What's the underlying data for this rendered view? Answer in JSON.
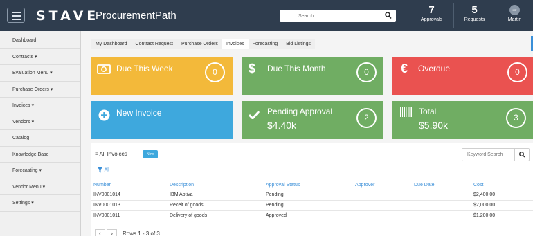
{
  "header": {
    "logo": "STAVE",
    "app_title": "ProcurementPath",
    "search_placeholder": "Search",
    "approvals": {
      "count": "7",
      "label": "Approvals"
    },
    "requests": {
      "count": "5",
      "label": "Requests"
    },
    "user": {
      "initials": "MP",
      "name": "Martin"
    },
    "colors": {
      "bar": "#2f3d4e"
    }
  },
  "sidebar": {
    "items": [
      {
        "label": "Dashboard"
      },
      {
        "label": "Contracts ▾"
      },
      {
        "label": "Evaluation Menu ▾"
      },
      {
        "label": "Purchase Orders ▾"
      },
      {
        "label": "Invoices ▾"
      },
      {
        "label": "Vendors ▾"
      },
      {
        "label": "Catalog"
      },
      {
        "label": "Knowledge Base"
      },
      {
        "label": "Forecasting ▾"
      },
      {
        "label": "Vendor Menu ▾"
      },
      {
        "label": "Settings ▾"
      }
    ]
  },
  "tabs": [
    {
      "label": "My Dashboard"
    },
    {
      "label": "Contract Request"
    },
    {
      "label": "Purchase Orders"
    },
    {
      "label": "Invoices",
      "active": true
    },
    {
      "label": "Forecasting"
    },
    {
      "label": "Bid Listings"
    }
  ],
  "tiles": {
    "due_week": {
      "label": "Due This Week",
      "count": "0",
      "icon": "money-icon",
      "color": "#f3b93a"
    },
    "due_month": {
      "label": "Due This Month",
      "count": "0",
      "icon": "dollar-icon",
      "color": "#70ad63"
    },
    "overdue": {
      "label": "Overdue",
      "count": "0",
      "icon": "euro-icon",
      "color": "#ea5250"
    },
    "new_invoice": {
      "label": "New Invoice",
      "icon": "plus-circle-icon",
      "color": "#3ea8dd"
    },
    "pending": {
      "label": "Pending Approval",
      "value": "$4.40k",
      "count": "2",
      "icon": "checkmark-icon",
      "color": "#70ad63"
    },
    "total": {
      "label": "Total",
      "value": "$5.90k",
      "count": "3",
      "icon": "barcode-icon",
      "color": "#70ad63"
    }
  },
  "invoices": {
    "title": "All Invoices",
    "new_label": "New",
    "keyword_placeholder": "Keyword Search",
    "filter_label": "All",
    "columns": [
      "Number",
      "Description",
      "Approval Status",
      "Approver",
      "Due Date",
      "Cost"
    ],
    "rows": [
      [
        "INV0001014",
        "IBM Aptiva",
        "Pending",
        "",
        "",
        "$2,400.00"
      ],
      [
        "INV0001013",
        "Receit of goods.",
        "Pending",
        "",
        "",
        "$2,000.00"
      ],
      [
        "INV0001011",
        "Delivery of goods",
        "Approved",
        "",
        "",
        "$1,200.00"
      ]
    ],
    "pager": {
      "prev": "‹",
      "next": "›",
      "info": "Rows 1 - 3 of 3"
    }
  }
}
